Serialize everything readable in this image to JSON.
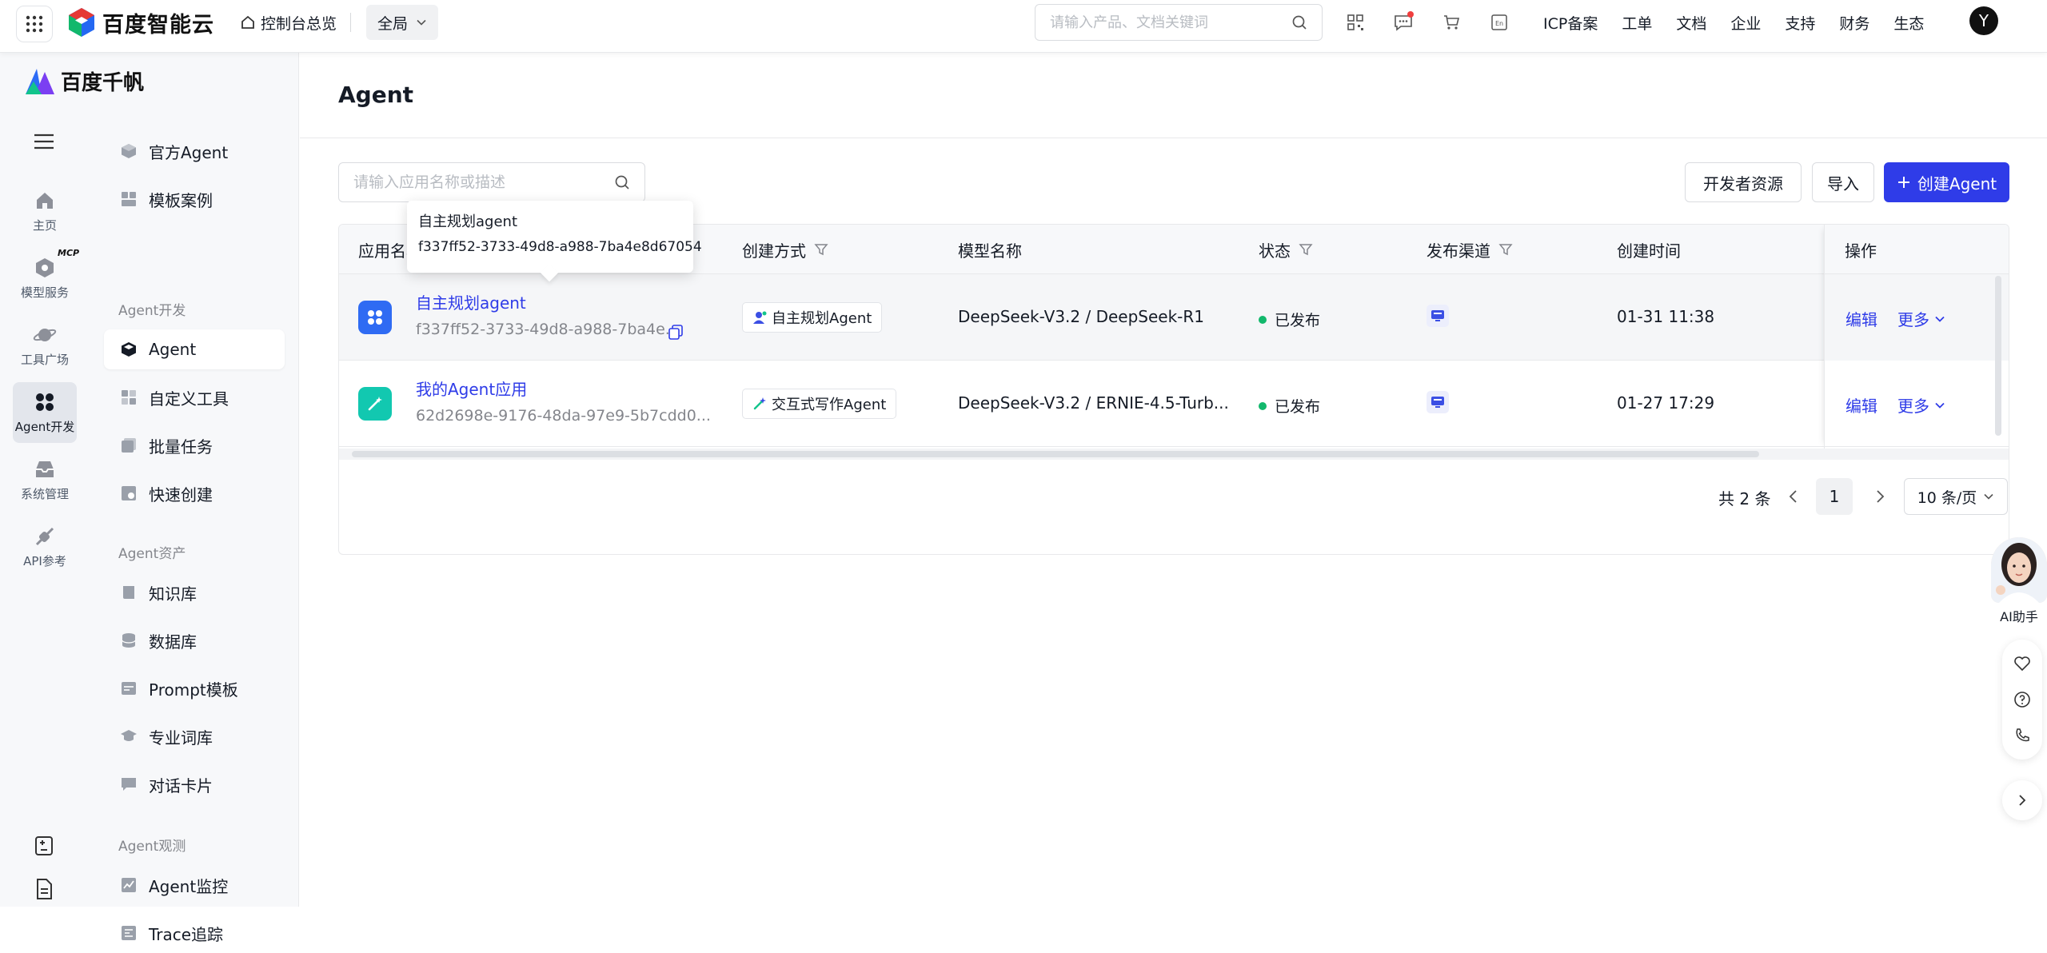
{
  "topbar": {
    "brand": "百度智能云",
    "home_link": "控制台总览",
    "scope": "全局",
    "search_placeholder": "请输入产品、文档关键词",
    "nav": [
      "ICP备案",
      "工单",
      "文档",
      "企业",
      "支持",
      "财务",
      "生态"
    ],
    "avatar": "Y",
    "icons": [
      "qrcode-icon",
      "message-icon",
      "cart-icon",
      "language-icon"
    ]
  },
  "sidebar": {
    "brand": "百度千帆",
    "rail": [
      {
        "label": "主页",
        "icon": "home-icon"
      },
      {
        "label": "模型服务",
        "icon": "model-icon"
      },
      {
        "label": "工具广场",
        "icon": "planet-icon",
        "badge": "MCP"
      },
      {
        "label": "Agent开发",
        "icon": "agent-dev-icon",
        "active": true
      },
      {
        "label": "系统管理",
        "icon": "inbox-icon"
      },
      {
        "label": "API参考",
        "icon": "api-icon"
      }
    ],
    "top_items": [
      {
        "label": "官方Agent",
        "icon": "cube-icon"
      },
      {
        "label": "模板案例",
        "icon": "template-icon"
      }
    ],
    "groups": [
      {
        "title": "Agent开发",
        "items": [
          {
            "label": "Agent",
            "icon": "cube-icon",
            "active": true
          },
          {
            "label": "自定义工具",
            "icon": "tool-icon"
          },
          {
            "label": "批量任务",
            "icon": "batch-icon"
          },
          {
            "label": "快速创建",
            "icon": "quick-icon"
          }
        ]
      },
      {
        "title": "Agent资产",
        "items": [
          {
            "label": "知识库",
            "icon": "book-icon"
          },
          {
            "label": "数据库",
            "icon": "database-icon"
          },
          {
            "label": "Prompt模板",
            "icon": "prompt-icon"
          },
          {
            "label": "专业词库",
            "icon": "cap-icon"
          },
          {
            "label": "对话卡片",
            "icon": "card-icon"
          }
        ]
      },
      {
        "title": "Agent观测",
        "items": [
          {
            "label": "Agent监控",
            "icon": "chart-icon"
          },
          {
            "label": "Trace追踪",
            "icon": "trace-icon"
          }
        ]
      }
    ]
  },
  "main": {
    "title": "Agent",
    "search_placeholder": "请输入应用名称或描述",
    "buttons": {
      "dev_resources": "开发者资源",
      "import": "导入",
      "create": "创建Agent"
    },
    "columns": [
      "应用名称",
      "创建方式",
      "模型名称",
      "状态",
      "发布渠道",
      "创建时间",
      "操作"
    ],
    "rows": [
      {
        "name": "自主规划agent",
        "id": "f337ff52-3733-49d8-a988-7ba4e...",
        "method": "自主规划Agent",
        "model": "DeepSeek-V3.2 / DeepSeek-R1",
        "status": "已发布",
        "created": "01-31 11:38",
        "edit": "编辑",
        "more": "更多"
      },
      {
        "name": "我的Agent应用",
        "id": "62d2698e-9176-48da-97e9-5b7cdd0...",
        "method": "交互式写作Agent",
        "model": "DeepSeek-V3.2 / ERNIE-4.5-Turb...",
        "status": "已发布",
        "created": "01-27 17:29",
        "edit": "编辑",
        "more": "更多"
      }
    ],
    "tooltip": {
      "title": "自主规划agent",
      "id": "f337ff52-3733-49d8-a988-7ba4e8d67054"
    },
    "pagination": {
      "total": "共 2 条",
      "current": "1",
      "page_size": "10 条/页"
    }
  },
  "floating": {
    "ai_label": "AI助手"
  },
  "colors": {
    "primary": "#2f3ce8",
    "success": "#12b86c",
    "sidebar_bg": "#f7f8fa"
  }
}
